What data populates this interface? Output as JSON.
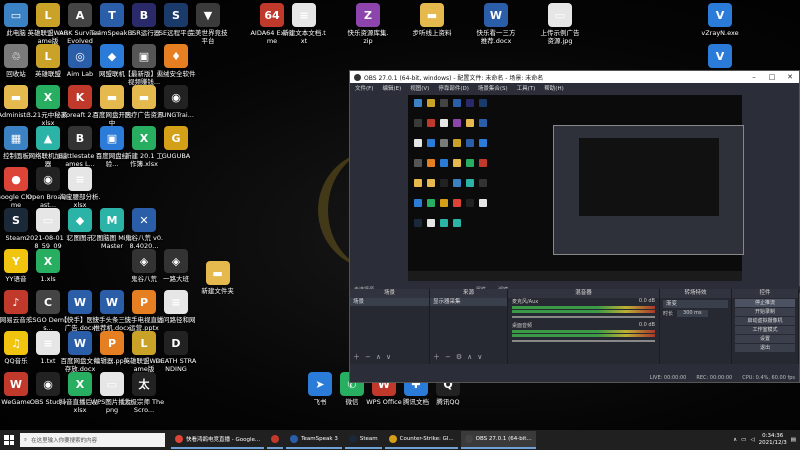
{
  "desktop": {
    "icons": [
      {
        "label": "此电脑",
        "color": "#3b82c4",
        "glyph": "▭"
      },
      {
        "label": "英雄联盟WeGame版",
        "color": "#c9a227",
        "glyph": "L"
      },
      {
        "label": "ARK Survival Evolved",
        "color": "#444444",
        "glyph": "A"
      },
      {
        "label": "TeamSpeak 3",
        "color": "#2b5ea8",
        "glyph": "T"
      },
      {
        "label": "BSR运行器",
        "color": "#2a2a6a",
        "glyph": "B"
      },
      {
        "label": "SE远程平台",
        "color": "#1a3a6a",
        "glyph": "S"
      },
      {
        "label": "完美世界竞技平台",
        "color": "#3a3a3a",
        "glyph": "▼"
      },
      {
        "label": "AIDA64 Extreme",
        "color": "#c0392b",
        "glyph": "64"
      },
      {
        "label": "新建文本文档.txt",
        "color": "#e6e6e6",
        "glyph": "≡"
      },
      {
        "label": "快乐资源库集.zip",
        "color": "#8e44ad",
        "glyph": "Z"
      },
      {
        "label": "步听线上资料",
        "color": "#e6b94f",
        "glyph": "▬"
      },
      {
        "label": "快乐看一三方推荐.docx",
        "color": "#2b5ea8",
        "glyph": "W"
      },
      {
        "label": "上传示例广告资源.jpg",
        "color": "#e6e6e6",
        "glyph": "▭"
      },
      {
        "label": "vZrayN.exe",
        "color": "#2b7bd8",
        "glyph": "V"
      },
      {
        "label": "回收站",
        "color": "#7a7a7a",
        "glyph": "♲"
      },
      {
        "label": "英雄联盟",
        "color": "#c9a227",
        "glyph": "L"
      },
      {
        "label": "Aim Lab",
        "color": "#2b5ea8",
        "glyph": "◎"
      },
      {
        "label": "网盟联机",
        "color": "#2b7bd8",
        "glyph": "◆"
      },
      {
        "label": "【最新版】看视频赚钱...",
        "color": "#555555",
        "glyph": "▣"
      },
      {
        "label": "火绒安全软件",
        "color": "#e67e22",
        "glyph": "♦"
      },
      {
        "label": "vZrayN",
        "color": "#2b7bd8",
        "glyph": "V"
      },
      {
        "label": "Administr...",
        "color": "#e6b94f",
        "glyph": "▬"
      },
      {
        "label": "3.21元中秘赢.xlsx",
        "color": "#27ae60",
        "glyph": "X"
      },
      {
        "label": "Koreaft 2.0",
        "color": "#c0392b",
        "glyph": "K"
      },
      {
        "label": "百度网盘开启中",
        "color": "#e6b94f",
        "glyph": "▬"
      },
      {
        "label": "医疗广告资源",
        "color": "#e6b94f",
        "glyph": "▬"
      },
      {
        "label": "FUNGTrai...",
        "color": "#222222",
        "glyph": "◉"
      },
      {
        "label": "控制面板",
        "color": "#3b82c4",
        "glyph": "▦"
      },
      {
        "label": "网络联机加速器",
        "color": "#2bb3a8",
        "glyph": "▲"
      },
      {
        "label": "Battlestate Games L...",
        "color": "#333333",
        "glyph": "B"
      },
      {
        "label": "百度网盘经验...",
        "color": "#2b7bd8",
        "glyph": "▣"
      },
      {
        "label": "新建 20.1 工作簿.xlsx",
        "color": "#27ae60",
        "glyph": "X"
      },
      {
        "label": "GUGUBA",
        "color": "#d4a017",
        "glyph": "G"
      },
      {
        "label": "Google Chrome",
        "color": "#db4437",
        "glyph": "●"
      },
      {
        "label": "Open Broadcast...",
        "color": "#222222",
        "glyph": "◉"
      },
      {
        "label": "淘宝腰部分析.xlsx",
        "color": "#e6e6e6",
        "glyph": "≡"
      },
      {
        "label": "Steam",
        "color": "#1b2838",
        "glyph": "S"
      },
      {
        "label": "2021-08-01 18_59_09",
        "color": "#e6e6e6",
        "glyph": "▭"
      },
      {
        "label": "亿图图示",
        "color": "#2bb3a8",
        "glyph": "◆"
      },
      {
        "label": "亿图脑图 MindMaster",
        "color": "#2bb3a8",
        "glyph": "M"
      },
      {
        "label": "鬼谷八荒 v0.8.4020...",
        "color": "#2b5ea8",
        "glyph": "✕"
      },
      {
        "label": "YY语音",
        "color": "#f1c40f",
        "glyph": "Y"
      },
      {
        "label": "1.xls",
        "color": "#27ae60",
        "glyph": "X"
      },
      {
        "label": "鬼谷八荒",
        "color": "#333333",
        "glyph": "◈"
      },
      {
        "label": "一路大班",
        "color": "#333333",
        "glyph": "◈"
      },
      {
        "label": "新建文件夹",
        "color": "#e6b94f",
        "glyph": "▬"
      },
      {
        "label": "网易云音乐",
        "color": "#c0392b",
        "glyph": "♪"
      },
      {
        "label": "CSGO Demos...",
        "color": "#444444",
        "glyph": "C"
      },
      {
        "label": "【快手】医疗广告.docx",
        "color": "#2b5ea8",
        "glyph": "W"
      },
      {
        "label": "快手头条三方推荐机.docx",
        "color": "#2b5ea8",
        "glyph": "W"
      },
      {
        "label": "快手电视直播运营.pptx",
        "color": "#e67e22",
        "glyph": "P"
      },
      {
        "label": "访问路径和网",
        "color": "#e6e6e6",
        "glyph": "≡"
      },
      {
        "label": "QQ音乐",
        "color": "#f1c40f",
        "glyph": "♫"
      },
      {
        "label": "1.txt",
        "color": "#e6e6e6",
        "glyph": "≡"
      },
      {
        "label": "百度网盘文件存放.docx",
        "color": "#2b5ea8",
        "glyph": "W"
      },
      {
        "label": "编辑器.pptx",
        "color": "#e67e22",
        "glyph": "P"
      },
      {
        "label": "英雄联盟WeGame版",
        "color": "#c9a227",
        "glyph": "L"
      },
      {
        "label": "DEATH STRANDING",
        "color": "#222222",
        "glyph": "D"
      },
      {
        "label": "WeGame",
        "color": "#c0392b",
        "glyph": "W"
      },
      {
        "label": "OBS Studio",
        "color": "#222222",
        "glyph": "◉"
      },
      {
        "label": "抖音直播后台.xlsx",
        "color": "#27ae60",
        "glyph": "X"
      },
      {
        "label": "WPS图片播放.png",
        "color": "#e6e6e6",
        "glyph": "▭"
      },
      {
        "label": "太极宗师 The Scro...",
        "color": "#222222",
        "glyph": "太"
      },
      {
        "label": "飞书",
        "color": "#2b7bd8",
        "glyph": "➤"
      },
      {
        "label": "微信",
        "color": "#27ae60",
        "glyph": "✆"
      },
      {
        "label": "WPS Office",
        "color": "#c0392b",
        "glyph": "W"
      },
      {
        "label": "腾讯文档",
        "color": "#2b7bd8",
        "glyph": "✚"
      },
      {
        "label": "腾讯QQ",
        "color": "#222222",
        "glyph": "Q"
      }
    ]
  },
  "obs": {
    "title": "OBS 27.0.1 (64-bit, windows) - 配置文件: 未命名 - 场景: 未命名",
    "menu": [
      "文件(F)",
      "编辑(E)",
      "视图(V)",
      "停靠部件(D)",
      "场景集合(S)",
      "工具(T)",
      "帮助(H)"
    ],
    "live_status": "未选择源",
    "properties_label": "属性",
    "filters_label": "滤镜",
    "docks": {
      "scenes": {
        "header": "场景",
        "items": [
          "场景"
        ]
      },
      "sources": {
        "header": "来源",
        "items": [
          "显示器采集"
        ]
      },
      "mixer": {
        "header": "混音器",
        "channels": [
          {
            "name": "麦克风/Aux",
            "db": "0.0 dB"
          },
          {
            "name": "桌面音频",
            "db": "0.0 dB"
          }
        ]
      },
      "transitions": {
        "header": "转场特效",
        "type": "渐变",
        "duration_label": "时长",
        "duration": "300 ms"
      },
      "controls": {
        "header": "控件",
        "buttons": [
          "停止推流",
          "开始录制",
          "启动虚拟摄像机",
          "工作室模式",
          "设置",
          "退出"
        ]
      }
    },
    "status": {
      "live": "LIVE: 00:00:00",
      "rec": "REC: 00:00:00",
      "cpu": "CPU: 0.4%, 60.00 fps"
    }
  },
  "taskbar": {
    "search_placeholder": "在这里输入你要搜索的内容",
    "items": [
      {
        "label": "快看鸿鹄电竞直播 - Google...",
        "color": "#db4437"
      },
      {
        "label": "",
        "color": "#c0392b"
      },
      {
        "label": "TeamSpeak 3",
        "color": "#2b5ea8"
      },
      {
        "label": "Steam",
        "color": "#1b2838"
      },
      {
        "label": "Counter-Strike: Gl...",
        "color": "#d4a017"
      },
      {
        "label": "OBS 27.0.1 (64-bit...",
        "color": "#444444"
      }
    ],
    "time": "0:34:36",
    "date": "2021/12/3"
  }
}
